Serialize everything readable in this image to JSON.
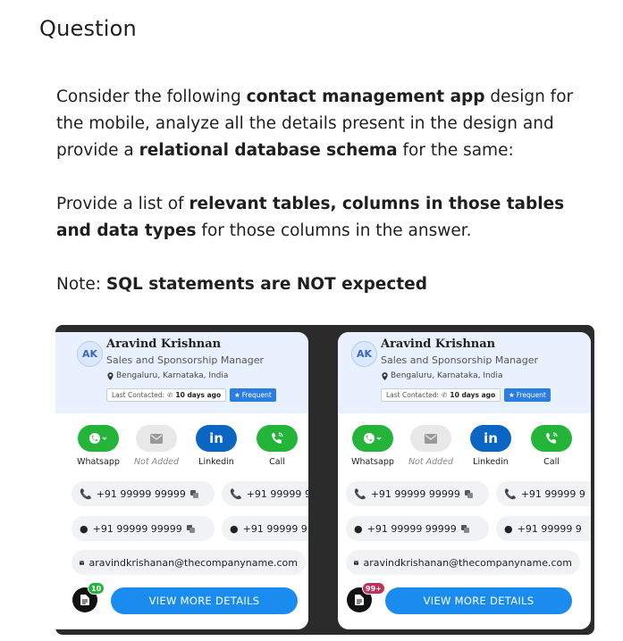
{
  "heading": "Question",
  "para1": {
    "t1": "Consider the following ",
    "b1": "contact management app",
    "t2": " design for the mobile, analyze all the details present in the design and provide a ",
    "b2": "relational database schema",
    "t3": " for the same:"
  },
  "para2": {
    "t1": "Provide a list of ",
    "b1": "relevant tables, columns in those tables and data types",
    "t2": " for those columns in the answer."
  },
  "para3": {
    "t1": "Note: ",
    "b1": "SQL statements are NOT expected"
  },
  "cards": [
    {
      "initials": "AK",
      "name": "Aravind Krishnan",
      "role": "Sales and Sponsorship Manager",
      "location": "Bengaluru, Karnataka, India",
      "last_contacted_label": "Last Contacted:",
      "last_contacted_value": "10 days ago",
      "frequent_label": "Frequent",
      "actions": [
        "Whatsapp",
        "Not Added",
        "Linkedin",
        "Call"
      ],
      "phone_1": "+91 99999 99999",
      "phone_2": "+91 99999 9",
      "whatsapp_1": "+91 99999 99999",
      "whatsapp_2": "+91 99999 9",
      "email": "aravindkrishanan@thecompanyname.com",
      "doc_badge": "10",
      "more_label": "VIEW MORE DETAILS"
    },
    {
      "initials": "AK",
      "name": "Aravind Krishnan",
      "role": "Sales and Sponsorship Manager",
      "location": "Bengaluru, Karnataka, India",
      "last_contacted_label": "Last Contacted:",
      "last_contacted_value": "10 days ago",
      "frequent_label": "Frequent",
      "actions": [
        "Whatsapp",
        "Not Added",
        "Linkedin",
        "Call"
      ],
      "phone_1": "+91 99999 99999",
      "phone_2": "+91 99999 9",
      "whatsapp_1": "+91 99999 99999",
      "whatsapp_2": "+91 99999 9",
      "email": "aravindkrishanan@thecompanyname.com",
      "doc_badge": "99+",
      "more_label": "VIEW MORE DETAILS"
    }
  ],
  "colors": {
    "whatsapp": "#25b43a",
    "linkedin": "#0a66c2",
    "frequent": "#2a7de1",
    "view_more": "#1a8cf0",
    "header_bg": "#e8f1fd"
  }
}
